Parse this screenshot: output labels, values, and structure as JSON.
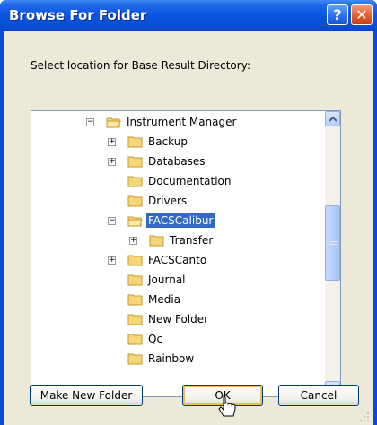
{
  "window": {
    "title": "Browse For Folder",
    "help_label": "?",
    "close_label": "✕"
  },
  "prompt": "Select location for Base Result Directory:",
  "tree": {
    "items": [
      {
        "label": "Instrument Manager",
        "expander": "−"
      },
      {
        "label": "Backup",
        "expander": "+"
      },
      {
        "label": "Databases",
        "expander": "+"
      },
      {
        "label": "Documentation",
        "expander": ""
      },
      {
        "label": "Drivers",
        "expander": ""
      },
      {
        "label": "FACSCalibur",
        "expander": "−",
        "selected": true
      },
      {
        "label": "Transfer",
        "expander": "+"
      },
      {
        "label": "FACSCanto",
        "expander": "+"
      },
      {
        "label": "Journal",
        "expander": ""
      },
      {
        "label": "Media",
        "expander": ""
      },
      {
        "label": "New Folder",
        "expander": ""
      },
      {
        "label": "Qc",
        "expander": ""
      },
      {
        "label": "Rainbow",
        "expander": ""
      }
    ]
  },
  "buttons": {
    "make_new_folder": "Make New Folder",
    "ok": "OK",
    "cancel": "Cancel"
  },
  "colors": {
    "titlebar": "#0955e0",
    "selection": "#316ac5",
    "dialog_bg": "#ece9d8",
    "folder": "#f5d77a"
  }
}
